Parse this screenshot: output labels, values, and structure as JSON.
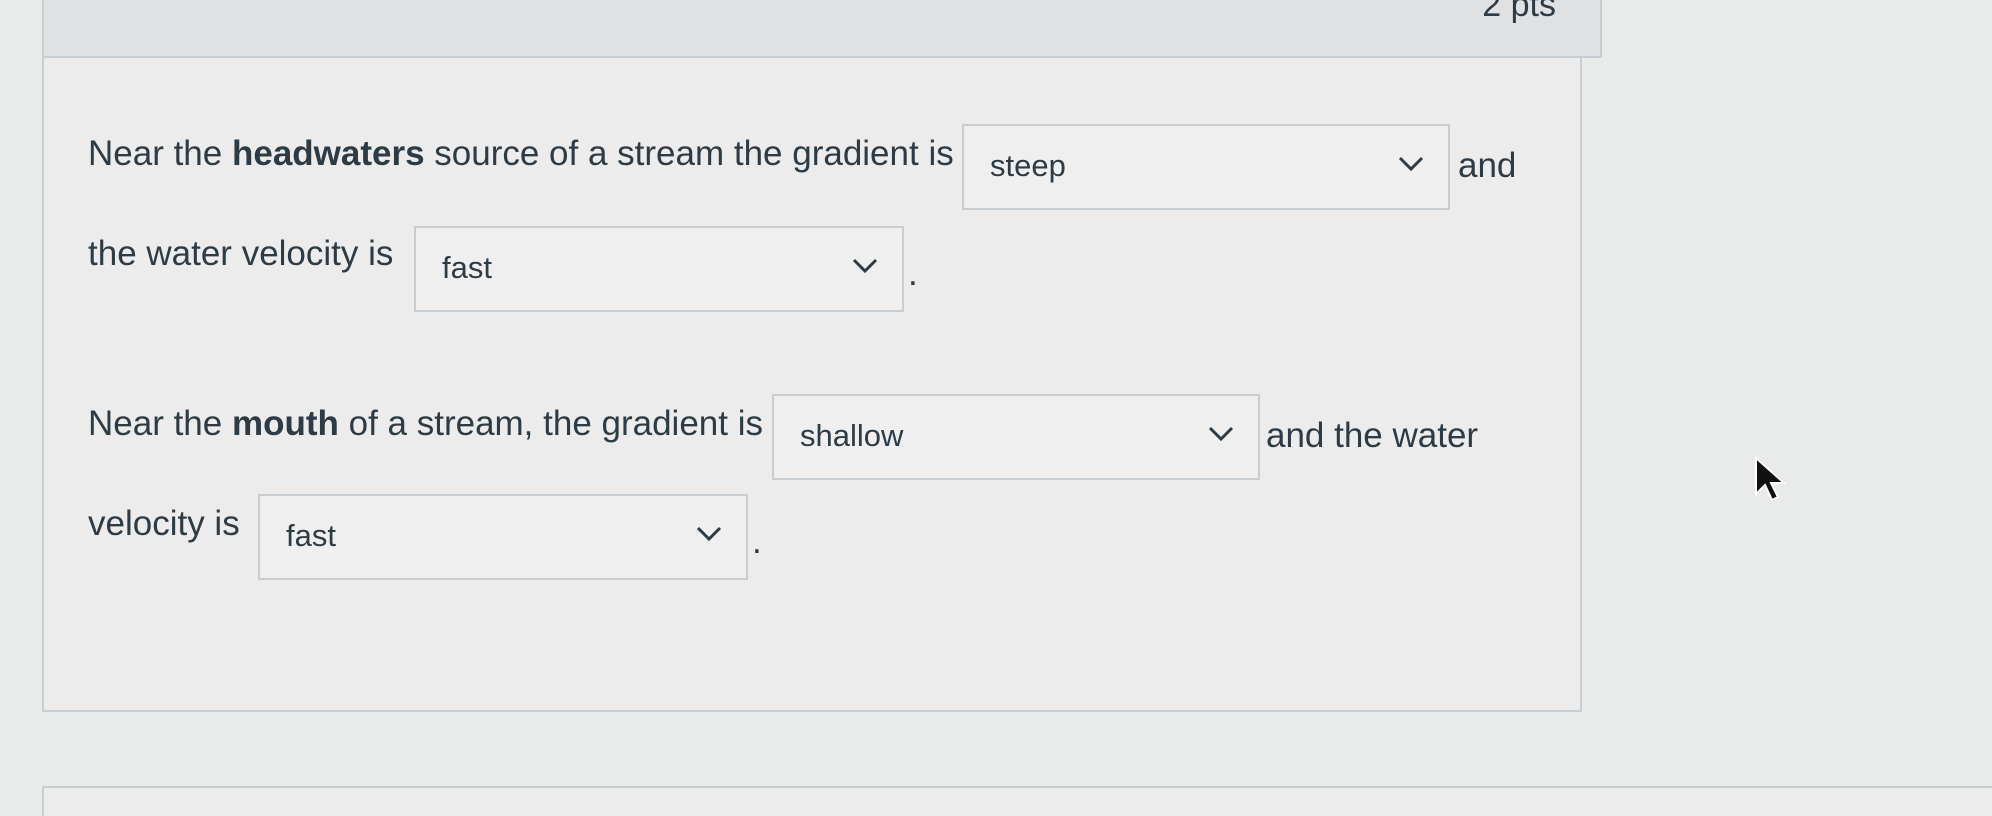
{
  "question": {
    "points": "2 pts"
  },
  "sentence1": {
    "part1_pre": "Near the ",
    "part1_bold": "headwaters",
    "part1_post": " source of a stream the gradient is",
    "dropdown1": {
      "selected": "steep"
    },
    "part2": "and",
    "part3": "the water velocity is",
    "dropdown2": {
      "selected": "fast"
    },
    "end": "."
  },
  "sentence2": {
    "part1_pre": "Near the ",
    "part1_bold": "mouth",
    "part1_post": " of a stream, the gradient is",
    "dropdown1": {
      "selected": "shallow"
    },
    "part2": "and the water",
    "part3": "velocity is",
    "dropdown2": {
      "selected": "fast"
    },
    "end": "."
  },
  "icons": {
    "dropdown": "chevron-down-icon",
    "pointer": "mouse-pointer-icon"
  }
}
